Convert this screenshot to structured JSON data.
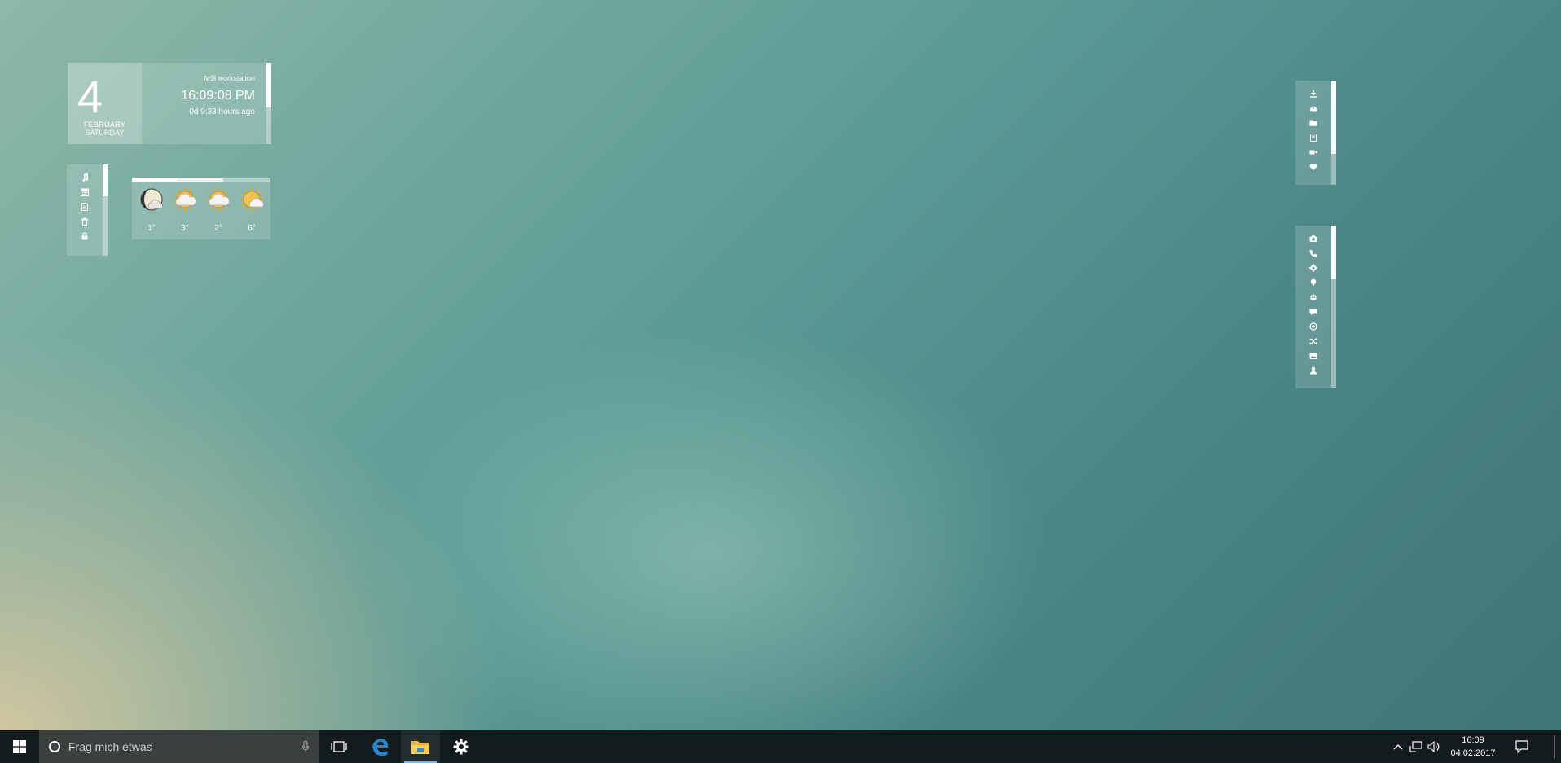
{
  "clock": {
    "day": "4",
    "month": "FEBRUARY",
    "weekday": "SATURDAY",
    "hostname": "fe9l workstation",
    "time": "16:09:08 PM",
    "uptime": "0d 9:33 hours ago",
    "bar_fill": 0.55
  },
  "left_launcher": {
    "icons": [
      "music-icon",
      "calendar-icon",
      "document-icon",
      "trash-icon",
      "lock-icon"
    ],
    "bar_fill": 0.35
  },
  "weather": {
    "days": [
      {
        "icon": "moon-cloud-icon",
        "temp": "1°"
      },
      {
        "icon": "sun-cloud-icon",
        "temp": "3°"
      },
      {
        "icon": "sun-cloud-icon",
        "temp": "2°"
      },
      {
        "icon": "sun-partly-icon",
        "temp": "6°"
      }
    ],
    "bar_segments": [
      0.33,
      0.33
    ]
  },
  "right_launcher_top": {
    "icons": [
      "download-icon",
      "cloud-upload-icon",
      "folder-icon",
      "notes-icon",
      "video-icon",
      "heart-icon"
    ],
    "bar_fill": 0.7
  },
  "right_launcher_bottom": {
    "icons": [
      "camera-icon",
      "phone-icon",
      "settings-icon",
      "pin-icon",
      "robot-icon",
      "chat-icon",
      "target-icon",
      "shuffle-icon",
      "image-icon",
      "user-icon"
    ],
    "bar_fill": 0.33
  },
  "taskbar": {
    "search_placeholder": "Frag mich etwas",
    "apps": [
      "task-view-icon",
      "edge-icon",
      "file-explorer-icon",
      "settings-gear-icon"
    ],
    "tray_time": "16:09",
    "tray_date": "04.02.2017"
  },
  "colors": {
    "taskbar_bg": "#131b1c",
    "search_bg": "#3a3f40",
    "edge_blue": "#1e8ad6",
    "explorer_yellow": "#f2c94c",
    "active_indicator": "#76b9ed"
  }
}
